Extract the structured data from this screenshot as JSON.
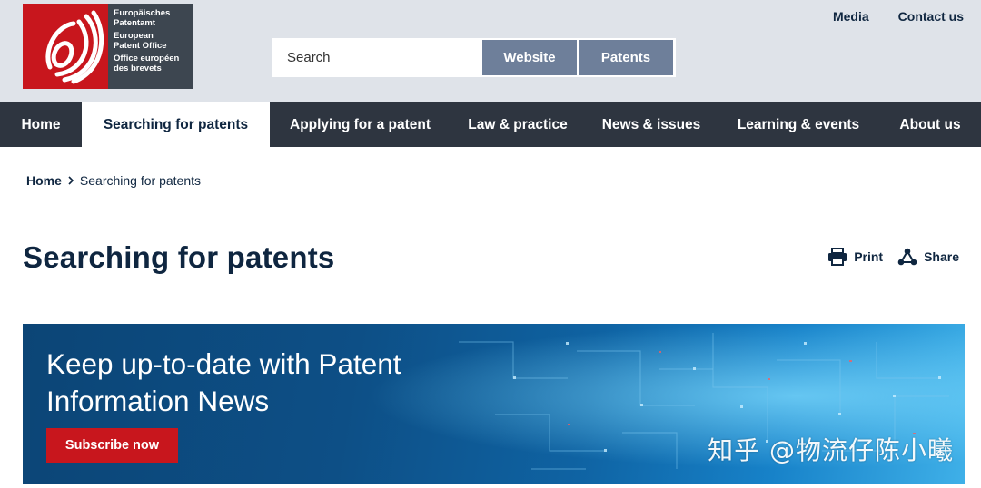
{
  "logo": {
    "text_lines": [
      "Europäisches",
      "Patentamt",
      "European",
      "Patent Office",
      "Office européen",
      "des brevets"
    ]
  },
  "top_links": {
    "media": "Media",
    "contact": "Contact us"
  },
  "search": {
    "placeholder": "Search",
    "website_label": "Website",
    "patents_label": "Patents"
  },
  "nav": {
    "items": [
      {
        "label": "Home"
      },
      {
        "label": "Searching for patents"
      },
      {
        "label": "Applying for a patent"
      },
      {
        "label": "Law & practice"
      },
      {
        "label": "News & issues"
      },
      {
        "label": "Learning & events"
      },
      {
        "label": "About us"
      }
    ]
  },
  "breadcrumb": {
    "home": "Home",
    "separator_icon": "chevron-right-icon",
    "current": "Searching for patents"
  },
  "page": {
    "title": "Searching for patents",
    "print_label": "Print",
    "share_label": "Share"
  },
  "banner": {
    "heading_line1": "Keep up-to-date with Patent",
    "heading_line2": "Information News",
    "cta_label": "Subscribe now",
    "watermark": "知乎 @物流仔陈小曦"
  },
  "colors": {
    "header_bg": "#dfe3e9",
    "nav_bg": "#2e3540",
    "brand_red": "#c8161d",
    "search_button": "#6e7f9a",
    "text_dark": "#0f2640",
    "banner_blue": "#0d4f86"
  }
}
